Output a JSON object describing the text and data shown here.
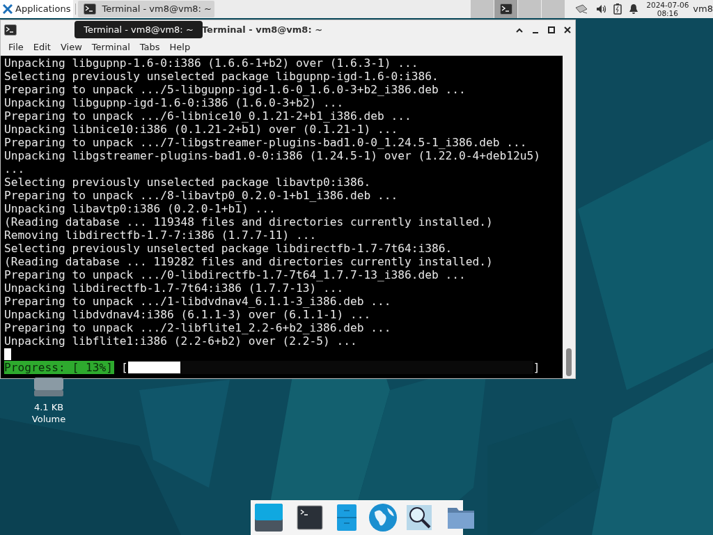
{
  "top_panel": {
    "applications_label": "Applications",
    "tasks": [
      {
        "label": "Terminal - vm8@vm8: ~",
        "selected": true
      }
    ],
    "workspaces": [
      {
        "selected": false
      },
      {
        "selected": true
      },
      {
        "selected": false
      },
      {
        "selected": false
      }
    ],
    "date": "2024-07-06",
    "time": "08:16",
    "user": "vm8"
  },
  "window": {
    "title": "Terminal - vm8@vm8: ~",
    "menu": [
      "File",
      "Edit",
      "View",
      "Terminal",
      "Tabs",
      "Help"
    ],
    "tooltip": "Terminal - vm8@vm8: ~",
    "lines": [
      "Unpacking libgupnp-1.6-0:i386 (1.6.6-1+b2) over (1.6.3-1) ...",
      "Selecting previously unselected package libgupnp-igd-1.6-0:i386.",
      "Preparing to unpack .../5-libgupnp-igd-1.6-0_1.6.0-3+b2_i386.deb ...",
      "Unpacking libgupnp-igd-1.6-0:i386 (1.6.0-3+b2) ...",
      "Preparing to unpack .../6-libnice10_0.1.21-2+b1_i386.deb ...",
      "Unpacking libnice10:i386 (0.1.21-2+b1) over (0.1.21-1) ...",
      "Preparing to unpack .../7-libgstreamer-plugins-bad1.0-0_1.24.5-1_i386.deb ...",
      "Unpacking libgstreamer-plugins-bad1.0-0:i386 (1.24.5-1) over (1.22.0-4+deb12u5)",
      "...",
      "Selecting previously unselected package libavtp0:i386.",
      "Preparing to unpack .../8-libavtp0_0.2.0-1+b1_i386.deb ...",
      "Unpacking libavtp0:i386 (0.2.0-1+b1) ...",
      "(Reading database ... 119348 files and directories currently installed.)",
      "Removing libdirectfb-1.7-7:i386 (1.7.7-11) ...",
      "Selecting previously unselected package libdirectfb-1.7-7t64:i386.",
      "(Reading database ... 119282 files and directories currently installed.)",
      "Preparing to unpack .../0-libdirectfb-1.7-7t64_1.7.7-13_i386.deb ...",
      "Unpacking libdirectfb-1.7-7t64:i386 (1.7.7-13) ...",
      "Preparing to unpack .../1-libdvdnav4_6.1.1-3_i386.deb ...",
      "Unpacking libdvdnav4:i386 (6.1.1-3) over (6.1.1-1) ...",
      "Preparing to unpack .../2-libflite1_2.2-6+b2_i386.deb ...",
      "Unpacking libflite1:i386 (2.2-6+b2) over (2.2-5) ..."
    ],
    "progress": {
      "label": "Progress: [ 13%]",
      "open_bracket": "[",
      "close_bracket": "]",
      "level": 0.13
    }
  },
  "desktop_icons": [
    {
      "size": "4.1 KB",
      "label": "Volume"
    }
  ],
  "dock": [
    {
      "kind": "desktop"
    },
    {
      "kind": "terminal"
    },
    {
      "kind": "files"
    },
    {
      "kind": "browser"
    },
    {
      "kind": "search"
    },
    {
      "kind": "folder"
    }
  ]
}
